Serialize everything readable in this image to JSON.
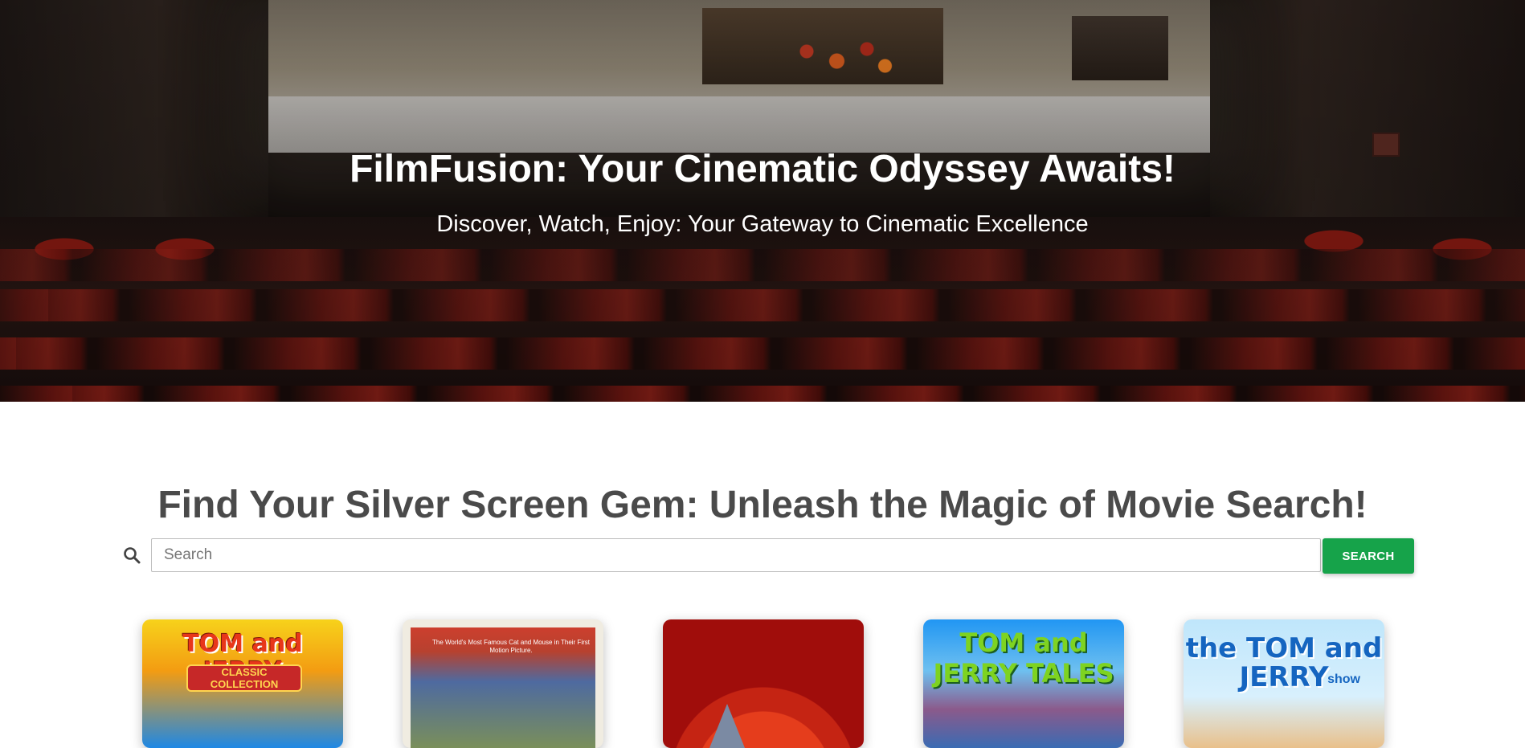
{
  "hero": {
    "title": "FilmFusion: Your Cinematic Odyssey Awaits!",
    "subtitle": "Discover, Watch, Enjoy: Your Gateway to Cinematic Excellence"
  },
  "search": {
    "heading": "Find Your Silver Screen Gem: Unleash the Magic of Movie Search!",
    "placeholder": "Search",
    "value": "",
    "button_label": "SEARCH",
    "button_color": "#16a34a"
  },
  "movies": [
    {
      "title_art": "TOM and JERRY",
      "subtitle_art": "CLASSIC COLLECTION"
    },
    {
      "title_art": "",
      "tagline_art": "The World's Most Famous Cat and Mouse in Their First Motion Picture."
    },
    {
      "title_art": ""
    },
    {
      "title_art": "TOM and JERRY TALES"
    },
    {
      "title_art": "the TOM and JERRY",
      "subtitle_art": "show"
    }
  ]
}
